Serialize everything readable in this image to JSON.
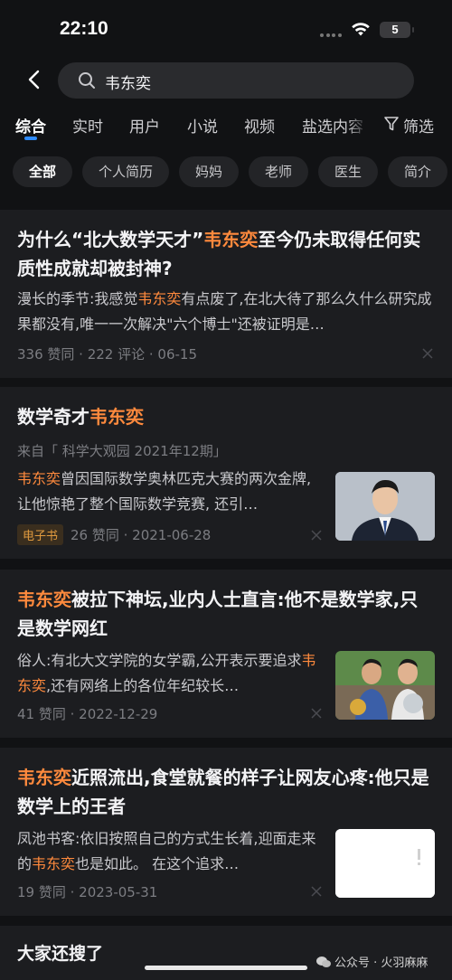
{
  "status": {
    "time": "22:10",
    "battery": "5"
  },
  "search": {
    "query": "韦东奕"
  },
  "tabs": [
    "综合",
    "实时",
    "用户",
    "小说",
    "视频",
    "盐选内容"
  ],
  "filter_label": "筛选",
  "chips": [
    "全部",
    "个人简历",
    "妈妈",
    "老师",
    "医生",
    "简介"
  ],
  "results": [
    {
      "title_pre": "为什么“北大数学天才”",
      "title_hl": "韦东奕",
      "title_post": "至今仍未取得任何实质性成就却被封神?",
      "excerpt_pre": "漫长的季节:我感觉",
      "excerpt_hl": "韦东奕",
      "excerpt_post": "有点废了,在北大待了那么久什么研究成果都没有,唯一一次解决\"六个博士\"还被证明是…",
      "meta": "336 赞同 · 222 评论 · 06-15"
    },
    {
      "title_pre": "数学奇才",
      "title_hl": "韦东奕",
      "title_post": "",
      "source": "来自「 科学大观园 2021年12期」",
      "excerpt_pre": "",
      "excerpt_hl": "韦东奕",
      "excerpt_post": "曾因国际数学奥林匹克大赛的两次金牌,让他惊艳了整个国际数学竞赛, 还引…",
      "badge": "电子书",
      "meta": "26 赞同 · 2021-06-28"
    },
    {
      "title_pre": "",
      "title_hl": "韦东奕",
      "title_post": "被拉下神坛,业内人士直言:他不是数学家,只是数学网红",
      "excerpt_pre": "俗人:有北大文学院的女学霸,公开表示要追求",
      "excerpt_hl": "韦东奕",
      "excerpt_post": ",还有网络上的各位年纪较长…",
      "meta": "41 赞同 · 2022-12-29"
    },
    {
      "title_pre": "",
      "title_hl": "韦东奕",
      "title_post": "近照流出,食堂就餐的样子让网友心疼:他只是数学上的王者",
      "excerpt_pre": "凤池书客:依旧按照自己的方式生长着,迎面走来的",
      "excerpt_hl": "韦东奕",
      "excerpt_post": "也是如此。 在这个追求…",
      "meta": "19 赞同 · 2023-05-31"
    }
  ],
  "more_title": "大家还搜了",
  "watermark": "公众号 · 火羽麻麻",
  "colors": {
    "highlight": "#ff8a3d",
    "tab_indicator": "#2f8cff",
    "background": "#111214",
    "card": "#1c1d20"
  }
}
